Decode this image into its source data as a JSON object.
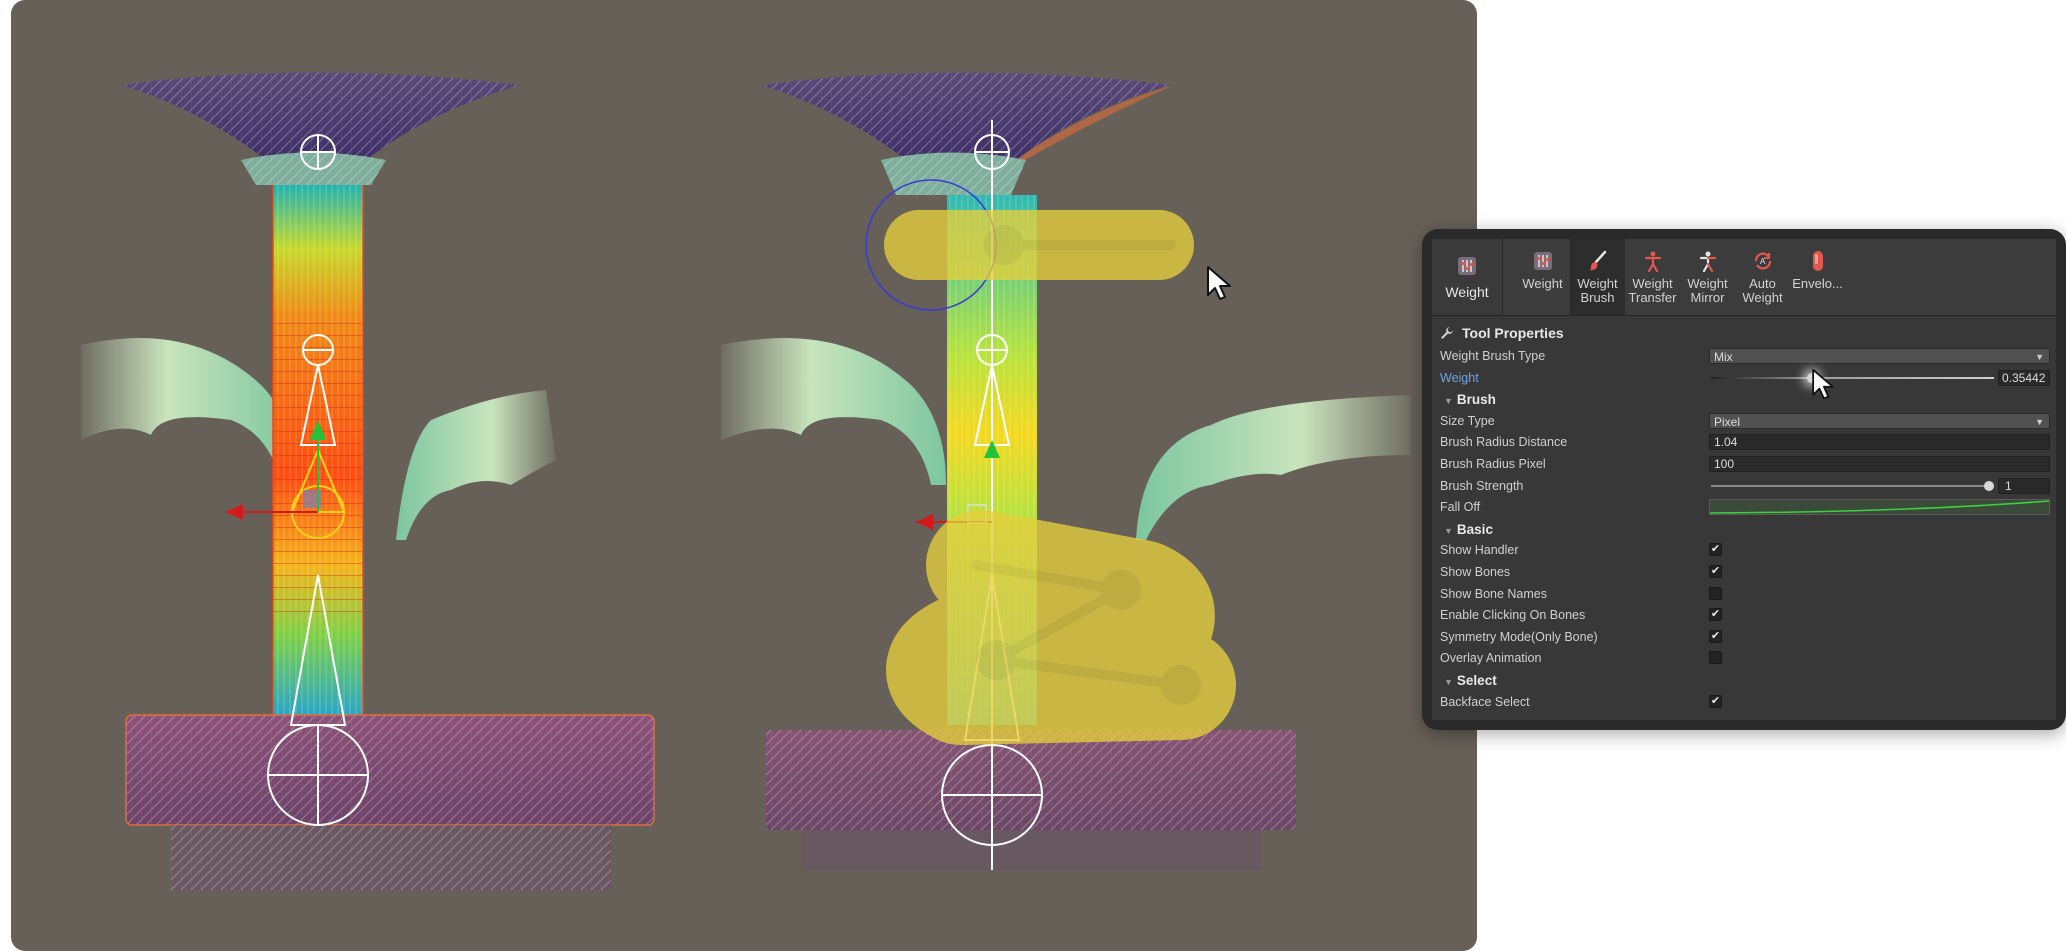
{
  "toolbar": {
    "main_label": "Weight",
    "tools": [
      {
        "label": "Weight"
      },
      {
        "label": "Weight\nBrush"
      },
      {
        "label": "Weight\nTransfer"
      },
      {
        "label": "Weight\nMirror"
      },
      {
        "label": "Auto\nWeight"
      },
      {
        "label": "Envelo..."
      }
    ]
  },
  "tool_properties": {
    "title": "Tool Properties",
    "weight_brush_type": {
      "label": "Weight Brush Type",
      "value": "Mix"
    },
    "weight": {
      "label": "Weight",
      "value": "0.35442",
      "fraction": 0.35442
    },
    "brush_header": "Brush",
    "size_type": {
      "label": "Size Type",
      "value": "Pixel"
    },
    "brush_radius_distance": {
      "label": "Brush Radius Distance",
      "value": "1.04"
    },
    "brush_radius_pixel": {
      "label": "Brush Radius Pixel",
      "value": "100"
    },
    "brush_strength": {
      "label": "Brush Strength",
      "value": "1",
      "fraction": 1
    },
    "fall_off": {
      "label": "Fall Off"
    },
    "basic_header": "Basic",
    "show_handler": {
      "label": "Show Handler",
      "checked": true
    },
    "show_bones": {
      "label": "Show Bones",
      "checked": true
    },
    "show_bone_names": {
      "label": "Show Bone Names",
      "checked": false
    },
    "enable_clicking_on_bones": {
      "label": "Enable Clicking On Bones",
      "checked": true
    },
    "symmetry_mode": {
      "label": "Symmetry Mode(Only Bone)",
      "checked": true
    },
    "overlay_animation": {
      "label": "Overlay Animation",
      "checked": false
    },
    "select_header": "Select",
    "backface_select": {
      "label": "Backface Select",
      "checked": true
    }
  },
  "colors": {
    "viewport_bg": "#666058",
    "panel_bg": "#383838",
    "accent_blue": "#6ea1e0",
    "gesture_yellow": "#e6cf3c"
  },
  "checkmark_glyph": "✔"
}
